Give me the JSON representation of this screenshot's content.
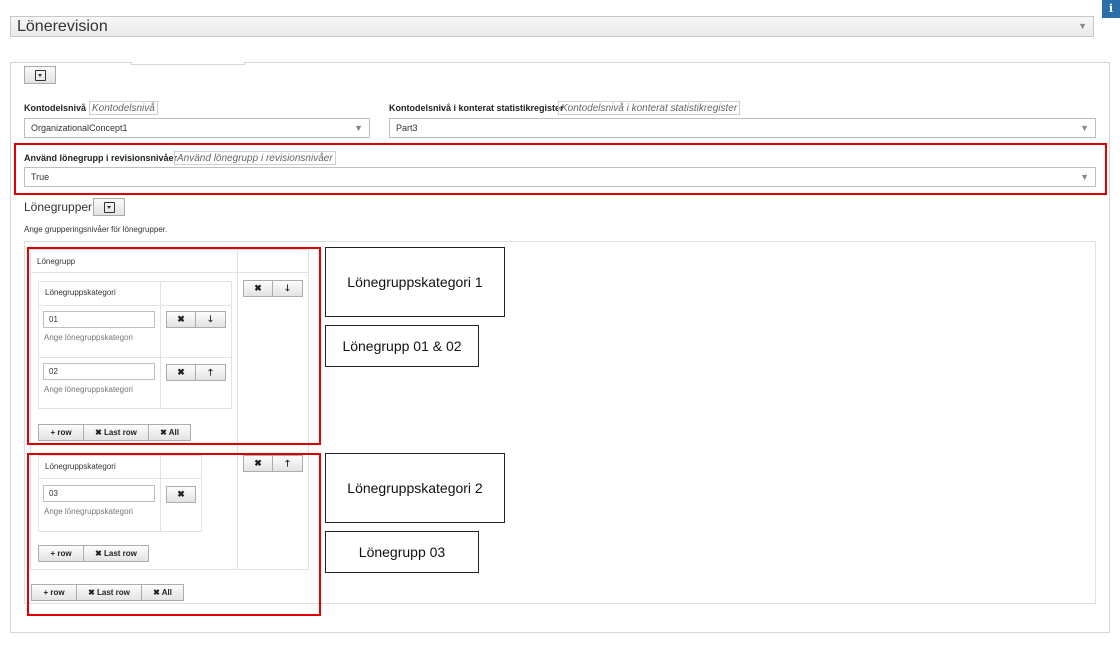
{
  "header": {
    "title": "Lönerevision",
    "info_icon_text": "i"
  },
  "fields": {
    "kontodelsniva": {
      "label": "Kontodelsnivå",
      "placeholder": "Kontodelsnivå",
      "value": "OrganizationalConcept1"
    },
    "kontodelsniva_stat": {
      "label": "Kontodelsnivå i konterat statistikregister",
      "placeholder": "Kontodelsnivå i konterat statistikregister",
      "value": "Part3"
    },
    "anvand_lonegrupp": {
      "label": "Använd lönegrupp i revisionsnivåer",
      "placeholder": "Använd lönegrupp i revisionsnivåer",
      "value": "True"
    }
  },
  "lonegrupper": {
    "title": "Lönegrupper",
    "hint": "Ange grupperingsnivåer för lönegrupper.",
    "outer_header": "Lönegrupp",
    "category_header": "Lönegruppskategori",
    "input_hint": "Ange lönegruppskategori",
    "group1": {
      "rows": [
        {
          "value": "01"
        },
        {
          "value": "02"
        }
      ]
    },
    "group2": {
      "rows": [
        {
          "value": "03"
        }
      ]
    }
  },
  "buttons": {
    "add_row": "+ row",
    "last_row": "✖ Last row",
    "all": "✖ All",
    "remove": "✖",
    "down": "🡓",
    "up": "🡑"
  },
  "annotations": {
    "a1": "Lönegruppskategori 1",
    "a2": "Lönegrupp 01 & 02",
    "a3": "Lönegruppskategori 2",
    "a4": "Lönegrupp 03"
  },
  "colors": {
    "highlight": "#e30000",
    "info": "#2a6fa8"
  }
}
